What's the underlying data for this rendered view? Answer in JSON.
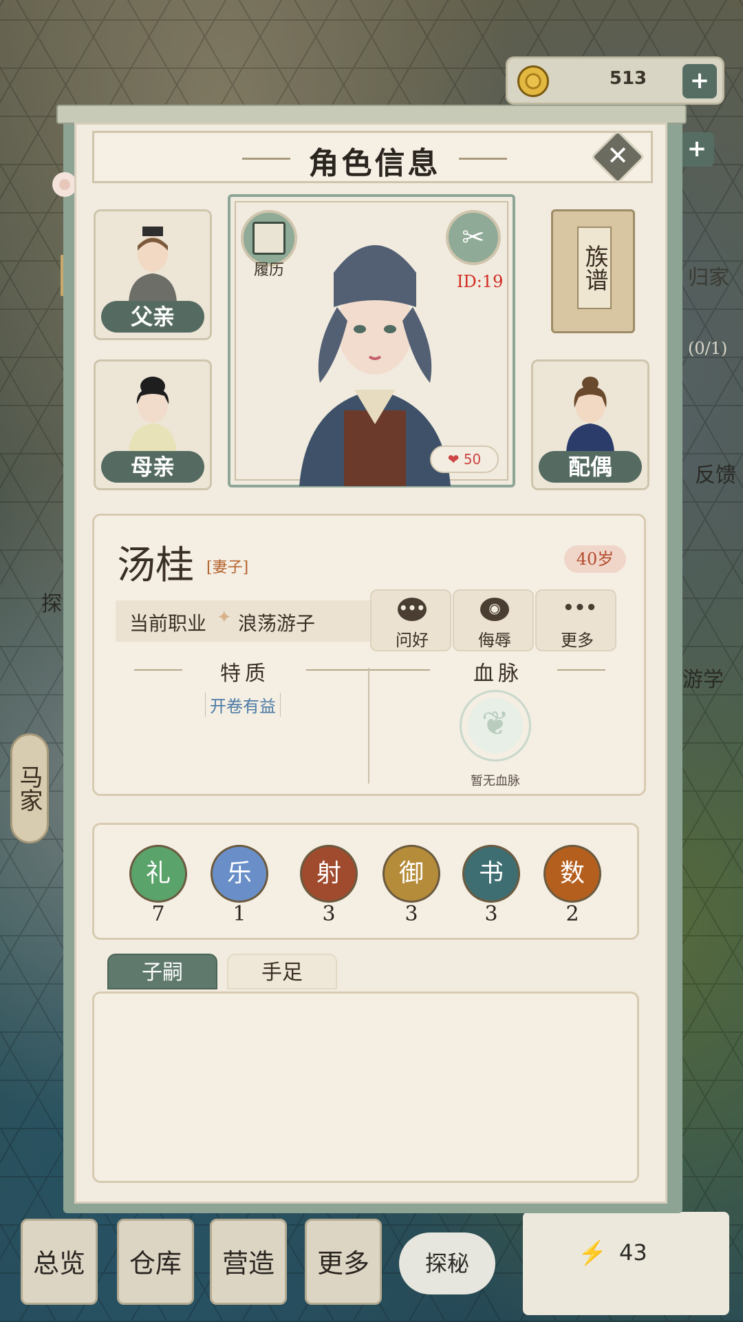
{
  "header": {
    "coins": "513",
    "plus": "+"
  },
  "background": {
    "side_label_home": "归家",
    "side_label_progress": "(0/1)",
    "side_label_feedback": "反馈",
    "side_label_tan": "探",
    "side_label_youxue": "游学",
    "family_button": "马家",
    "nav": [
      "总览",
      "仓库",
      "营造",
      "更多"
    ],
    "explore": "探秘",
    "energy": "43"
  },
  "dialog": {
    "title": "角色信息",
    "close": "✕",
    "relatives": {
      "father": "父亲",
      "mother": "母亲",
      "spouse": "配偶"
    },
    "genealogy": "族谱",
    "resume": "履历",
    "id": "ID:19",
    "heart": "50",
    "name": "汤桂",
    "role": "[妻子]",
    "age": "40岁",
    "job_label": "当前职业",
    "job_value": "浪荡游子",
    "actions": [
      {
        "label": "问好",
        "icon": "speech-icon"
      },
      {
        "label": "侮辱",
        "icon": "angry-face-icon"
      },
      {
        "label": "更多",
        "icon": "ellipsis-icon"
      }
    ],
    "traits_title": "特质",
    "traits": [
      "开卷有益"
    ],
    "bloodline_title": "血脉",
    "no_bloodline": "暂无血脉",
    "skills": [
      {
        "name": "礼",
        "value": "7",
        "color": "#5aa36b"
      },
      {
        "name": "乐",
        "value": "1",
        "color": "#6a8fc8"
      },
      {
        "name": "射",
        "value": "3",
        "color": "#a04a2e"
      },
      {
        "name": "御",
        "value": "3",
        "color": "#b58c3a"
      },
      {
        "name": "书",
        "value": "3",
        "color": "#3f6e72"
      },
      {
        "name": "数",
        "value": "2",
        "color": "#b45f1e"
      }
    ],
    "tabs": [
      "子嗣",
      "手足"
    ]
  }
}
